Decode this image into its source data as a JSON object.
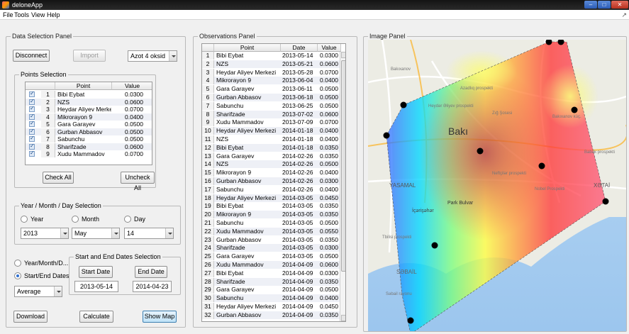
{
  "window": {
    "title": "deloneApp"
  },
  "menu": [
    "File",
    "Tools",
    "View",
    "Help"
  ],
  "data_panel": {
    "title": "Data Selection Panel",
    "disconnect_label": "Disconnect",
    "import_label": "Import",
    "pollutant_select": "Azot 4 oksid",
    "points_title": "Points Selection",
    "points_headers": [
      "Point",
      "Value"
    ],
    "points": [
      {
        "n": "1",
        "point": "Bibi Eybat",
        "value": "0.0300"
      },
      {
        "n": "2",
        "point": "NZS",
        "value": "0.0600"
      },
      {
        "n": "3",
        "point": "Heydar Aliyev Merkezi",
        "value": "0.0700"
      },
      {
        "n": "4",
        "point": "Mikrorayon 9",
        "value": "0.0400"
      },
      {
        "n": "5",
        "point": "Gara Garayev",
        "value": "0.0500"
      },
      {
        "n": "6",
        "point": "Gurban Abbasov",
        "value": "0.0500"
      },
      {
        "n": "7",
        "point": "Sabunchu",
        "value": "0.0500"
      },
      {
        "n": "8",
        "point": "Sharifzade",
        "value": "0.0600"
      },
      {
        "n": "9",
        "point": "Xudu Mammadov",
        "value": "0.0700"
      }
    ],
    "check_all_label": "Check All",
    "uncheck_all_label": "Uncheck All",
    "ymd_title": "Year / Month / Day Selection",
    "radio_year": "Year",
    "radio_month": "Month",
    "radio_day": "Day",
    "year_value": "2013",
    "month_value": "May",
    "day_value": "14",
    "radio_ymd": "Year/Month/D...",
    "radio_startend": "Start/End Dates",
    "dates_title": "Start and End Dates Selection",
    "start_date_label": "Start Date",
    "end_date_label": "End Date",
    "start_date_value": "2013-05-14",
    "end_date_value": "2014-04-23",
    "aggregate_select": "Average",
    "download_label": "Download",
    "calculate_label": "Calculate",
    "show_map_label": "Show Map"
  },
  "observations": {
    "title": "Observations Panel",
    "headers": [
      "Point",
      "Date",
      "Value"
    ],
    "rows": [
      {
        "n": "1",
        "point": "Bibi Eybat",
        "date": "2013-05-14",
        "value": "0.0300"
      },
      {
        "n": "2",
        "point": "NZS",
        "date": "2013-05-21",
        "value": "0.0600"
      },
      {
        "n": "3",
        "point": "Heydar Aliyev Merkezi",
        "date": "2013-05-28",
        "value": "0.0700"
      },
      {
        "n": "4",
        "point": "Mikrorayon 9",
        "date": "2013-06-04",
        "value": "0.0400"
      },
      {
        "n": "5",
        "point": "Gara Garayev",
        "date": "2013-06-11",
        "value": "0.0500"
      },
      {
        "n": "6",
        "point": "Gurban Abbasov",
        "date": "2013-06-18",
        "value": "0.0500"
      },
      {
        "n": "7",
        "point": "Sabunchu",
        "date": "2013-06-25",
        "value": "0.0500"
      },
      {
        "n": "8",
        "point": "Sharifzade",
        "date": "2013-07-02",
        "value": "0.0600"
      },
      {
        "n": "9",
        "point": "Xudu Mammadov",
        "date": "2013-07-09",
        "value": "0.0700"
      },
      {
        "n": "10",
        "point": "Heydar Aliyev Merkezi",
        "date": "2014-01-18",
        "value": "0.0400"
      },
      {
        "n": "11",
        "point": "NZS",
        "date": "2014-01-18",
        "value": "0.0400"
      },
      {
        "n": "12",
        "point": "Bibi Eybat",
        "date": "2014-01-18",
        "value": "0.0350"
      },
      {
        "n": "13",
        "point": "Gara Garayev",
        "date": "2014-02-26",
        "value": "0.0350"
      },
      {
        "n": "14",
        "point": "NZS",
        "date": "2014-02-26",
        "value": "0.0500"
      },
      {
        "n": "15",
        "point": "Mikrorayon 9",
        "date": "2014-02-26",
        "value": "0.0400"
      },
      {
        "n": "16",
        "point": "Gurban Abbasov",
        "date": "2014-02-26",
        "value": "0.0300"
      },
      {
        "n": "17",
        "point": "Sabunchu",
        "date": "2014-02-26",
        "value": "0.0400"
      },
      {
        "n": "18",
        "point": "Heydar Aliyev Merkezi",
        "date": "2014-03-05",
        "value": "0.0450"
      },
      {
        "n": "19",
        "point": "Bibi Eybat",
        "date": "2014-03-05",
        "value": "0.0350"
      },
      {
        "n": "20",
        "point": "Mikrorayon 9",
        "date": "2014-03-05",
        "value": "0.0350"
      },
      {
        "n": "21",
        "point": "Sabunchu",
        "date": "2014-03-05",
        "value": "0.0500"
      },
      {
        "n": "22",
        "point": "Xudu Mammadov",
        "date": "2014-03-05",
        "value": "0.0550"
      },
      {
        "n": "23",
        "point": "Gurban Abbasov",
        "date": "2014-03-05",
        "value": "0.0350"
      },
      {
        "n": "24",
        "point": "Sharifzade",
        "date": "2014-03-05",
        "value": "0.0300"
      },
      {
        "n": "25",
        "point": "Gara Garayev",
        "date": "2014-03-05",
        "value": "0.0500"
      },
      {
        "n": "26",
        "point": "Xudu Mammadov",
        "date": "2014-04-09",
        "value": "0.0600"
      },
      {
        "n": "27",
        "point": "Bibi Eybat",
        "date": "2014-04-09",
        "value": "0.0300"
      },
      {
        "n": "28",
        "point": "Sharifzade",
        "date": "2014-04-09",
        "value": "0.0350"
      },
      {
        "n": "29",
        "point": "Gara Garayev",
        "date": "2014-04-09",
        "value": "0.0500"
      },
      {
        "n": "30",
        "point": "Sabunchu",
        "date": "2014-04-09",
        "value": "0.0400"
      },
      {
        "n": "31",
        "point": "Heydar Aliyev Merkezi",
        "date": "2014-04-09",
        "value": "0.0450"
      },
      {
        "n": "32",
        "point": "Gurban Abbasov",
        "date": "2014-04-09",
        "value": "0.0350"
      }
    ]
  },
  "image_panel": {
    "title": "Image Panel",
    "map_labels": [
      "Bakı",
      "YASAMAL",
      "XƏTAİ",
      "Park Bulvar",
      "İçərişəhər",
      "SƏBAİL",
      "Bakıxanov",
      "Zığ Şosesi",
      "Neftçilər prospekti",
      "Heydər Əliyev prospekti",
      "Babək prospekti",
      "Nobel Prospekti",
      "Azadlıq prospekti",
      "Tbilisi prospekti",
      "Bakıxanov küç.",
      "Səbail rayonu"
    ],
    "station_count": 10
  }
}
